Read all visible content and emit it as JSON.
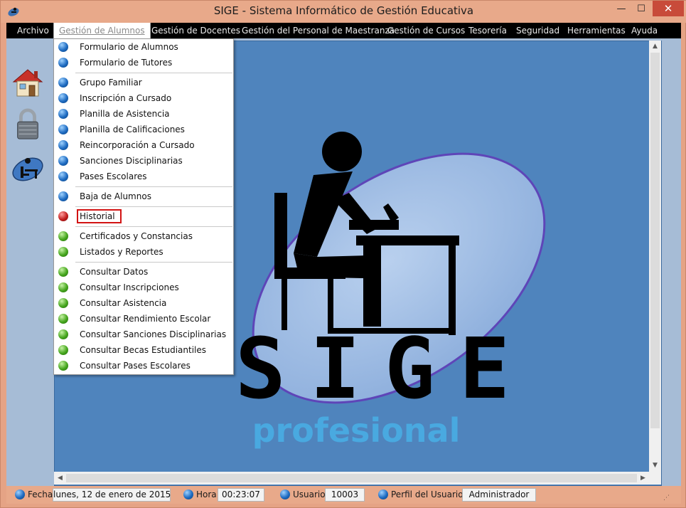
{
  "window": {
    "title": "SIGE - Sistema Informático de Gestión Educativa",
    "minimize_glyph": "—",
    "maximize_glyph": "☐",
    "close_glyph": "✕"
  },
  "menubar": {
    "items": [
      {
        "label": "Archivo"
      },
      {
        "label": "Gestión de Alumnos"
      },
      {
        "label": "Gestión de Docentes"
      },
      {
        "label": "Gestión del Personal de Maestranza"
      },
      {
        "label": "Gestión de Cursos"
      },
      {
        "label": "Tesorería"
      },
      {
        "label": "Seguridad"
      },
      {
        "label": "Herramientas"
      },
      {
        "label": "Ayuda"
      }
    ],
    "active_index": 1
  },
  "toolbar": {
    "icons": [
      "home-icon",
      "padlock-icon",
      "student-desk-icon"
    ]
  },
  "dropdown": {
    "items": [
      {
        "label": "Formulario de Alumnos",
        "bullet": "blue"
      },
      {
        "label": "Formulario de Tutores",
        "bullet": "blue"
      },
      {
        "label": "Grupo Familiar",
        "bullet": "blue"
      },
      {
        "label": "Inscripción a Cursado",
        "bullet": "blue"
      },
      {
        "label": "Planilla de Asistencia",
        "bullet": "blue"
      },
      {
        "label": "Planilla de Calificaciones",
        "bullet": "blue"
      },
      {
        "label": "Reincorporación a Cursado",
        "bullet": "blue"
      },
      {
        "label": "Sanciones Disciplinarias",
        "bullet": "blue"
      },
      {
        "label": "Pases Escolares",
        "bullet": "blue"
      },
      {
        "label": "Baja de Alumnos",
        "bullet": "blue"
      },
      {
        "label": "Historial",
        "bullet": "red"
      },
      {
        "label": "Certificados y Constancias",
        "bullet": "green"
      },
      {
        "label": "Listados y Reportes",
        "bullet": "green"
      },
      {
        "label": "Consultar Datos",
        "bullet": "green"
      },
      {
        "label": "Consultar Inscripciones",
        "bullet": "green"
      },
      {
        "label": "Consultar Asistencia",
        "bullet": "green"
      },
      {
        "label": "Consultar Rendimiento Escolar",
        "bullet": "green"
      },
      {
        "label": "Consultar Sanciones Disciplinarias",
        "bullet": "green"
      },
      {
        "label": "Consultar Becas Estudiantiles",
        "bullet": "green"
      },
      {
        "label": "Consultar Pases Escolares",
        "bullet": "green"
      }
    ],
    "highlighted_label": "Historial"
  },
  "logo": {
    "wordmark": "SIGE",
    "tagline": "profesional"
  },
  "statusbar": {
    "fecha_label": "Fecha",
    "fecha_value": "lunes, 12 de enero de 2015",
    "hora_label": "Hora",
    "hora_value": "00:23:07",
    "usuario_label": "Usuario",
    "usuario_value": "10003",
    "perfil_label": "Perfil del Usuario",
    "perfil_value": "Administrador"
  },
  "colors": {
    "chrome": "#e8a98a",
    "mdi_background": "#4f84bd",
    "client_background": "#a6bcd6",
    "highlight_border": "#d21313"
  }
}
